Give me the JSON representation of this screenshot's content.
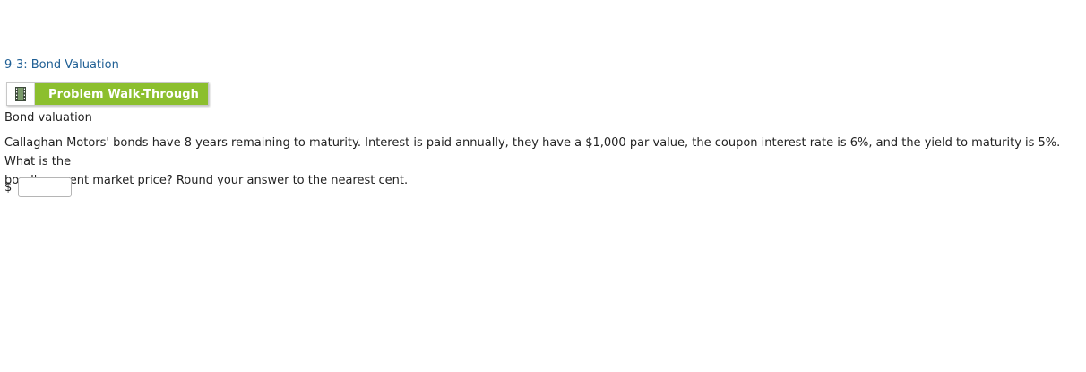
{
  "section_link": "9-3: Bond Valuation",
  "walkthrough": {
    "label": "Problem Walk-Through",
    "icon": "film-strip-icon",
    "accent_color": "#8cbf2e"
  },
  "heading": "Bond valuation",
  "question": {
    "line1": "Callaghan Motors' bonds have 8 years remaining to maturity. Interest is paid annually, they have a $1,000 par value, the coupon interest rate is 6%, and the yield to maturity is 5%. What is the",
    "line2": "bond's current market price? Round your answer to the nearest cent."
  },
  "answer": {
    "currency": "$",
    "value": "",
    "placeholder": ""
  },
  "colors": {
    "link": "#1f5f94",
    "text": "#222222"
  }
}
